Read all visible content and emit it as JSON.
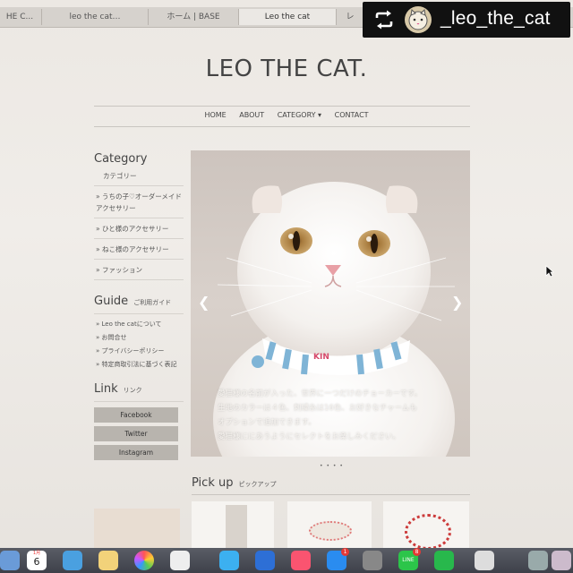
{
  "browser": {
    "tabs": [
      "HE C...",
      "leo the cat…",
      "ホーム | BASE",
      "Leo the cat",
      "レ"
    ]
  },
  "repost": {
    "handle": "_leo_the_cat"
  },
  "site": {
    "title": "LEO THE CAT.",
    "nav": [
      "HOME",
      "ABOUT",
      "CATEGORY ▾",
      "CONTACT"
    ]
  },
  "sidebar": {
    "category_heading": "Category",
    "category_sub": "カテゴリー",
    "categories": [
      "» うちの子♡オーダーメイドアクセサリー",
      "» ひと様のアクセサリー",
      "» ねこ様のアクセサリー",
      "» ファッション"
    ],
    "guide_heading": "Guide",
    "guide_sub": "ご利用ガイド",
    "guides": [
      "» Leo the catについて",
      "» お問合せ",
      "» プライバシーポリシー",
      "» 特定商取引法に基づく表記"
    ],
    "link_heading": "Link",
    "link_sub": "リンク",
    "links": [
      "Facebook",
      "Twitter",
      "Instagram"
    ]
  },
  "hero": {
    "text": [
      "愛猫様の名前が入った、世界に一つだけのチョーカーです。",
      "生地のカラーは４色、刺繍糸は16色、お好きなチャームも",
      "オプションで追加できます。",
      "愛猫様ににあうようにセレクトをお楽しみください。"
    ],
    "collar_name": "KIN",
    "dots": "• • • •"
  },
  "pickup": {
    "heading": "Pick up",
    "sub": "ピックアップ"
  },
  "dock": {
    "calendar_month": "1月",
    "calendar_day": "6",
    "line_label": "LINE",
    "badges": [
      "1",
      "8"
    ]
  }
}
